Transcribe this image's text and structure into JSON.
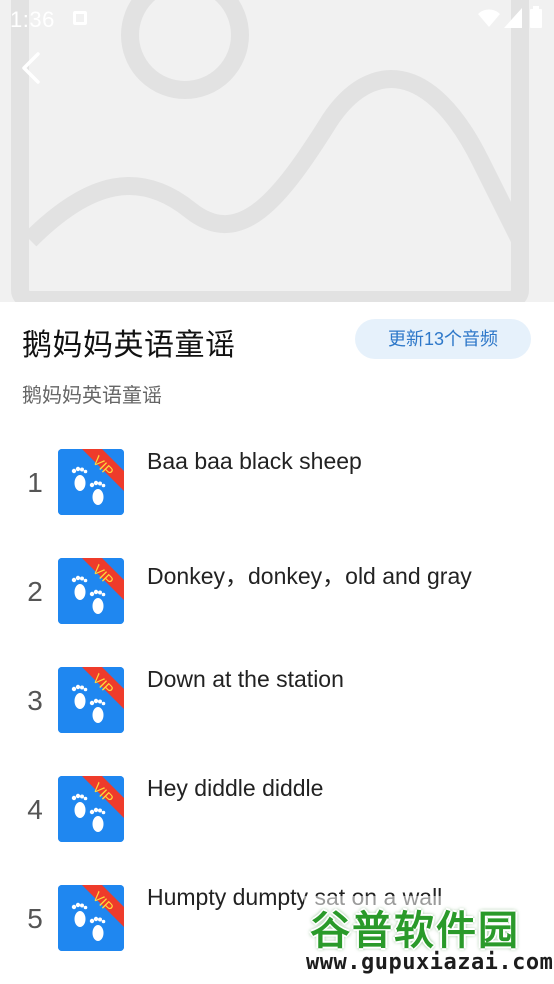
{
  "status_bar": {
    "time": "1:36"
  },
  "navigation": {
    "back_icon": "chevron-left-icon"
  },
  "album": {
    "title": "鹅妈妈英语童谣",
    "update_label": "更新13个音频",
    "subtitle": "鹅妈妈英语童谣"
  },
  "tracks": [
    {
      "number": "1",
      "title": "Baa baa black sheep",
      "badge": "VIP"
    },
    {
      "number": "2",
      "title": "Donkey，donkey，old and gray",
      "badge": "VIP"
    },
    {
      "number": "3",
      "title": "Down at the station",
      "badge": "VIP"
    },
    {
      "number": "4",
      "title": "Hey diddle diddle",
      "badge": "VIP"
    },
    {
      "number": "5",
      "title": "Humpty dumpty sat on a wall",
      "badge": "VIP"
    }
  ],
  "watermark": {
    "name": "谷普软件园",
    "url": "www.gupuxiazai.com"
  },
  "colors": {
    "accent_blue": "#1f87f0",
    "pill_background": "#e6f1fb",
    "pill_text": "#2e78c9",
    "vip_ribbon": "#ee3b2b",
    "vip_text": "#ffd93b"
  }
}
